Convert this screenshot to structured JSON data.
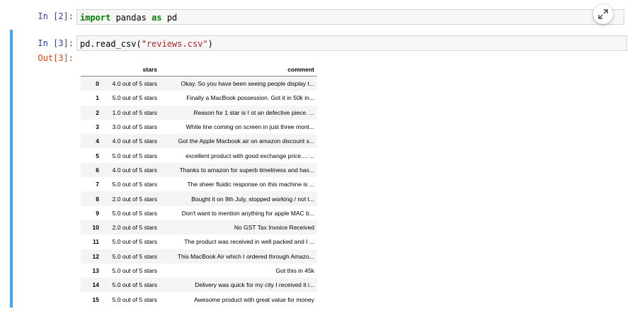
{
  "cell1": {
    "prompt": "In [2]:",
    "code": {
      "kw1": "import",
      "mid": " pandas ",
      "kw2": "as",
      "end": " pd"
    }
  },
  "cell2": {
    "prompt": "In [3]:",
    "code": {
      "pre": "pd.read_csv(",
      "str": "\"reviews.csv\"",
      "post": ")"
    },
    "out_prompt": "Out[3]:",
    "expand_icon": "expand-arrows-icon"
  },
  "table": {
    "columns": [
      "",
      "stars",
      "comment"
    ],
    "rows": [
      {
        "index": "0",
        "stars": "4.0 out of 5 stars",
        "comment": "Okay. So you have been seeing people display t..."
      },
      {
        "index": "1",
        "stars": "5.0 out of 5 stars",
        "comment": "Finally a MacBook possession. Got it in 50k in..."
      },
      {
        "index": "2",
        "stars": "1.0 out of 5 stars",
        "comment": "Reason for 1 star is I ot an defective piece. ..."
      },
      {
        "index": "3",
        "stars": "3.0 out of 5 stars",
        "comment": "White line coming on screen in just three mont..."
      },
      {
        "index": "4",
        "stars": "4.0 out of 5 stars",
        "comment": "Got the Apple Macbook air on amazon discount s..."
      },
      {
        "index": "5",
        "stars": "5.0 out of 5 stars",
        "comment": "excellent product with good exchange price.... ..."
      },
      {
        "index": "6",
        "stars": "4.0 out of 5 stars",
        "comment": "Thanks to amazon for superb timeliness and has..."
      },
      {
        "index": "7",
        "stars": "5.0 out of 5 stars",
        "comment": "The sheer fluidic response on this machine is ..."
      },
      {
        "index": "8",
        "stars": "2.0 out of 5 stars",
        "comment": "Bought it on 9th July, stopped working / not t..."
      },
      {
        "index": "9",
        "stars": "5.0 out of 5 stars",
        "comment": "Don't want to mention anything for apple MAC b..."
      },
      {
        "index": "10",
        "stars": "2.0 out of 5 stars",
        "comment": "No GST Tax Invoice Received"
      },
      {
        "index": "11",
        "stars": "5.0 out of 5 stars",
        "comment": "The product was received in well packed and I ..."
      },
      {
        "index": "12",
        "stars": "5.0 out of 5 stars",
        "comment": "This MacBook Air which I ordered through Amazo..."
      },
      {
        "index": "13",
        "stars": "5.0 out of 5 stars",
        "comment": "Got this in 45k"
      },
      {
        "index": "14",
        "stars": "5.0 out of 5 stars",
        "comment": "Delivery was quick for my city I received it i..."
      },
      {
        "index": "15",
        "stars": "5.0 out of 5 stars",
        "comment": "Awesome product with great value for money"
      }
    ]
  }
}
